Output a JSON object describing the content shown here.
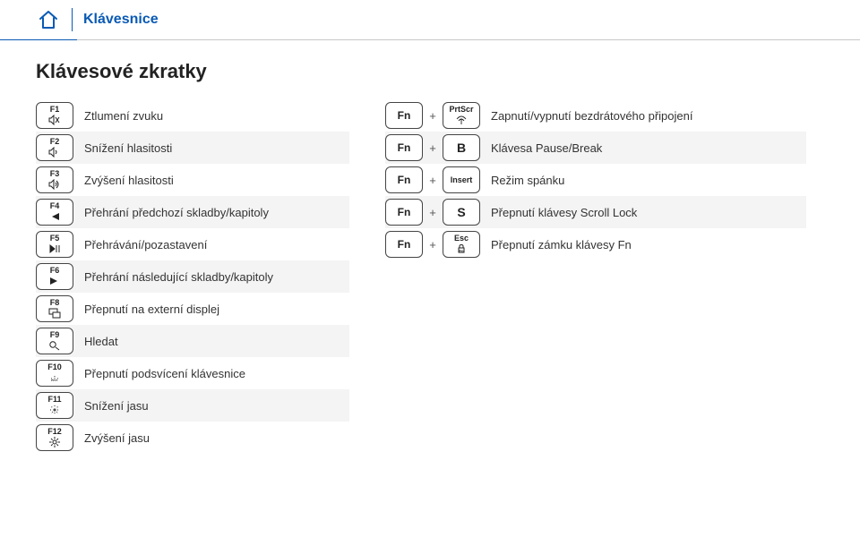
{
  "breadcrumb": "Klávesnice",
  "title": "Klávesové zkratky",
  "left": [
    {
      "key_top": "F1",
      "desc": "Ztlumení zvuku",
      "alt": false
    },
    {
      "key_top": "F2",
      "desc": "Snížení hlasitosti",
      "alt": true
    },
    {
      "key_top": "F3",
      "desc": "Zvýšení hlasitosti",
      "alt": false
    },
    {
      "key_top": "F4",
      "desc": "Přehrání předchozí skladby/kapitoly",
      "alt": true
    },
    {
      "key_top": "F5",
      "desc": "Přehrávání/pozastavení",
      "alt": false
    },
    {
      "key_top": "F6",
      "desc": "Přehrání následující skladby/kapitoly",
      "alt": true
    },
    {
      "key_top": "F8",
      "desc": "Přepnutí na externí displej",
      "alt": false
    },
    {
      "key_top": "F9",
      "desc": "Hledat",
      "alt": true
    },
    {
      "key_top": "F10",
      "desc": "Přepnutí podsvícení klávesnice",
      "alt": false
    },
    {
      "key_top": "F11",
      "desc": "Snížení jasu",
      "alt": true
    },
    {
      "key_top": "F12",
      "desc": "Zvýšení jasu",
      "alt": false
    }
  ],
  "fn_label": "Fn",
  "plus": "+",
  "right": [
    {
      "second_top": "PrtScr",
      "second_letter": "",
      "desc": "Zapnutí/vypnutí bezdrátového připojení",
      "alt": false
    },
    {
      "second_top": "",
      "second_letter": "B",
      "desc": "Klávesa Pause/Break",
      "alt": true
    },
    {
      "second_top": "Insert",
      "second_letter": "",
      "desc": "Režim spánku",
      "alt": false
    },
    {
      "second_top": "",
      "second_letter": "S",
      "desc": "Přepnutí klávesy Scroll Lock",
      "alt": true
    },
    {
      "second_top": "Esc",
      "second_letter": "",
      "desc": "Přepnutí zámku klávesy Fn",
      "alt": false
    }
  ]
}
